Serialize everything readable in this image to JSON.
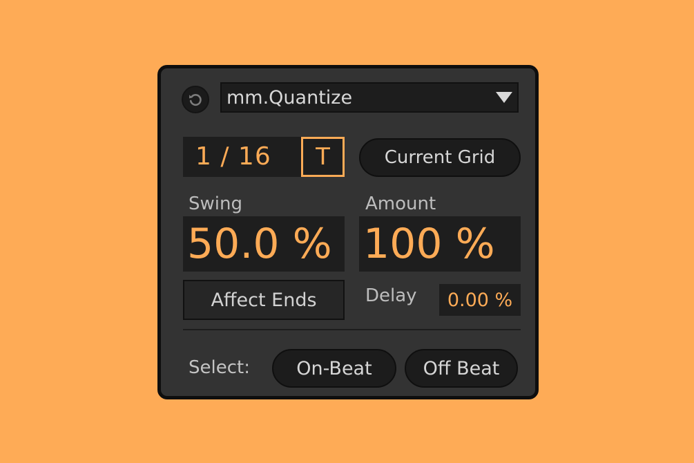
{
  "device": {
    "preset_name": "mm.Quantize",
    "grid_value": "1 / 16",
    "triplet_toggle": "T",
    "current_grid_label": "Current Grid",
    "swing_label": "Swing",
    "swing_value": "50.0 %",
    "amount_label": "Amount",
    "amount_value": "100 %",
    "affect_ends_label": "Affect Ends",
    "delay_label": "Delay",
    "delay_value": "0.00 %",
    "select_label": "Select:",
    "on_beat_label": "On-Beat",
    "off_beat_label": "Off Beat"
  },
  "icons": {
    "reset": "reset-icon",
    "dropdown": "chevron-down-icon"
  },
  "colors": {
    "background": "#FEAB56",
    "panel": "#333333",
    "accent": "#FEAB56",
    "field": "#1e1e1e"
  }
}
